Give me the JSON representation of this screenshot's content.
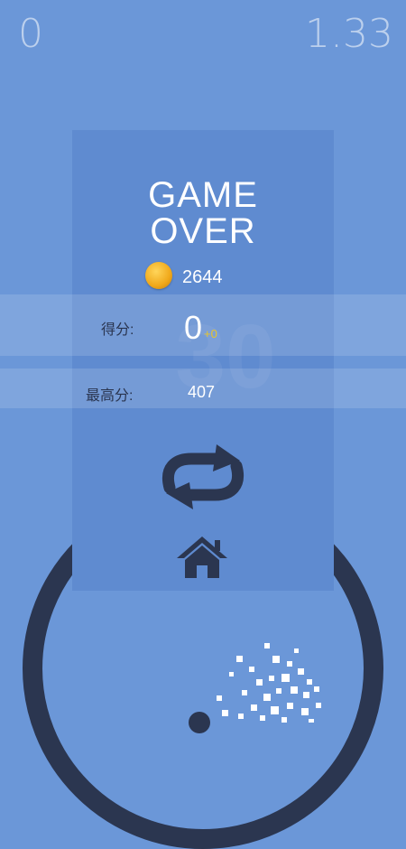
{
  "hud": {
    "score": "0",
    "timer": "1.33"
  },
  "panel": {
    "title_line1": "GAME",
    "title_line2": "OVER",
    "coins": "2644",
    "score_label": "得分:",
    "score_value": "0",
    "score_delta": "+0",
    "best_label": "最高分:",
    "best_value": "407",
    "watermark": "30"
  },
  "icons": {
    "coin": "coin-icon",
    "restart": "restart-icon",
    "home": "home-icon"
  },
  "colors": {
    "background": "#6b97d8",
    "panel": "#5f8bd0",
    "ring": "#2b3650",
    "coin": "#f0a81a",
    "delta": "#e8c52a",
    "text": "#ffffff",
    "label": "#2a3550"
  }
}
